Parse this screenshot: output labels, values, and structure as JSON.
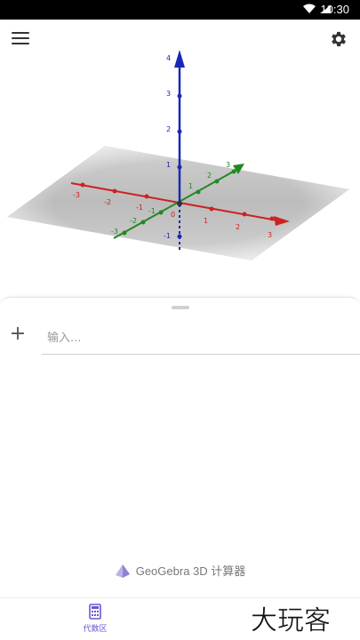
{
  "status_bar": {
    "time": "10:30"
  },
  "graphics_view": {
    "x_axis_ticks": [
      "-3",
      "-2",
      "-1",
      "0",
      "1",
      "2",
      "3"
    ],
    "y_axis_ticks": [
      "-3",
      "-2",
      "-1",
      "1",
      "2",
      "3"
    ],
    "z_axis_ticks": [
      "-1",
      "1",
      "2",
      "3",
      "4"
    ],
    "colors": {
      "x_axis": "#cc2222",
      "y_axis": "#228822",
      "z_axis": "#1b28b4",
      "plane": "#bdbdbd"
    }
  },
  "algebra": {
    "input_placeholder": "输入..."
  },
  "footer": {
    "brand": "GeoGebra 3D 计算器"
  },
  "bottom_nav": {
    "algebra_label": "代数区"
  },
  "watermark": {
    "text": "大玩客"
  },
  "icons": [
    "wifi-icon",
    "battery-icon",
    "menu-icon",
    "gear-icon",
    "plus-icon",
    "geogebra-logo-icon",
    "calculator-icon"
  ]
}
